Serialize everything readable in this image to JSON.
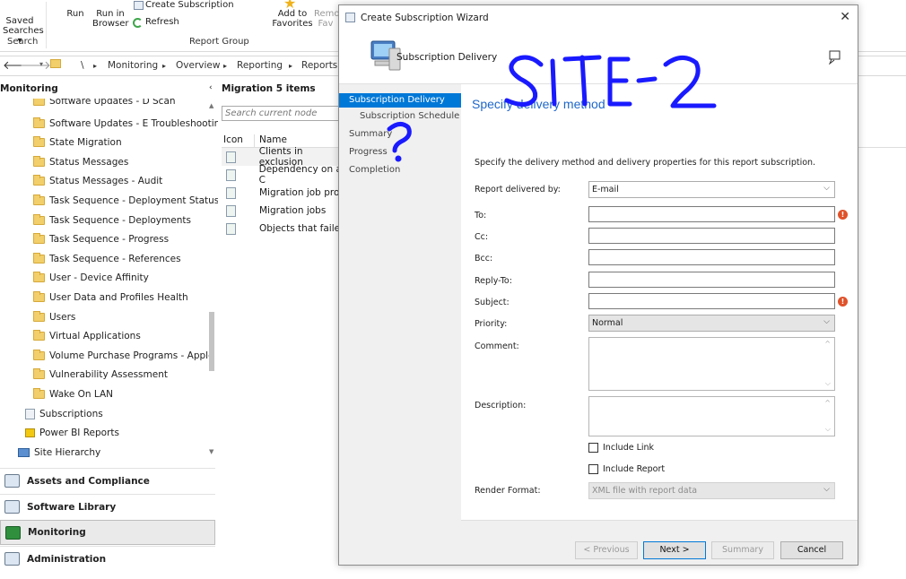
{
  "ribbon": {
    "saved_searches": "Saved Searches ▾",
    "run": "Run",
    "run_in_browser": "Run in Browser",
    "create_subscription": "Create Subscription",
    "refresh": "Refresh",
    "add_to_favorites": "Add to Favorites",
    "remove_favorites": "Remo Fav",
    "group_search": "Search",
    "group_report": "Report Group"
  },
  "breadcrumb": {
    "items": [
      "\\",
      "Monitoring",
      "Overview",
      "Reporting",
      "Reports"
    ],
    "sep": "▸"
  },
  "left_pane": {
    "header": "Monitoring",
    "tree": [
      "Software Updates - D Scan",
      "Software Updates - E Troubleshooting",
      "State Migration",
      "Status Messages",
      "Status Messages - Audit",
      "Task Sequence - Deployment Status",
      "Task Sequence - Deployments",
      "Task Sequence - Progress",
      "Task Sequence - References",
      "User - Device Affinity",
      "User Data and Profiles Health",
      "Users",
      "Virtual Applications",
      "Volume Purchase Programs - Apple",
      "Vulnerability Assessment",
      "Wake On LAN"
    ],
    "subscriptions": "Subscriptions",
    "power_bi": "Power BI Reports",
    "site_hierarchy": "Site Hierarchy",
    "workspaces": [
      "Assets and Compliance",
      "Software Library",
      "Monitoring",
      "Administration"
    ]
  },
  "middle": {
    "header": "Migration 5 items",
    "search_placeholder": "Search current node",
    "col_icon": "Icon",
    "col_name": "Name",
    "rows": [
      "Clients in exclusion",
      "Dependency on a C",
      "Migration job prop",
      "Migration jobs",
      "Objects that failed"
    ]
  },
  "dialog": {
    "title": "Create Subscription Wizard",
    "close": "✕",
    "banner_title": "Subscription Delivery",
    "steps": [
      "Subscription Delivery",
      "Subscription Schedule",
      "Summary",
      "Progress",
      "Completion"
    ],
    "heading": "Specify delivery method",
    "intro": "Specify the delivery method and delivery properties for this report subscription.",
    "fields": {
      "delivered_by_label": "Report delivered by:",
      "delivered_by_value": "E-mail",
      "to_label": "To:",
      "cc_label": "Cc:",
      "bcc_label": "Bcc:",
      "reply_to_label": "Reply-To:",
      "subject_label": "Subject:",
      "priority_label": "Priority:",
      "priority_value": "Normal",
      "comment_label": "Comment:",
      "description_label": "Description:",
      "include_link": "Include Link",
      "include_report": "Include Report",
      "render_format_label": "Render Format:",
      "render_format_value": "XML file with report data"
    },
    "buttons": {
      "previous": "< Previous",
      "next": "Next >",
      "summary": "Summary",
      "cancel": "Cancel"
    }
  },
  "annotation": {
    "text": "SITE-2",
    "mark": "?"
  },
  "colors": {
    "accent": "#0078d7",
    "heading": "#1e67c9",
    "scrawl": "#1a1aff",
    "error": "#e0522a"
  }
}
